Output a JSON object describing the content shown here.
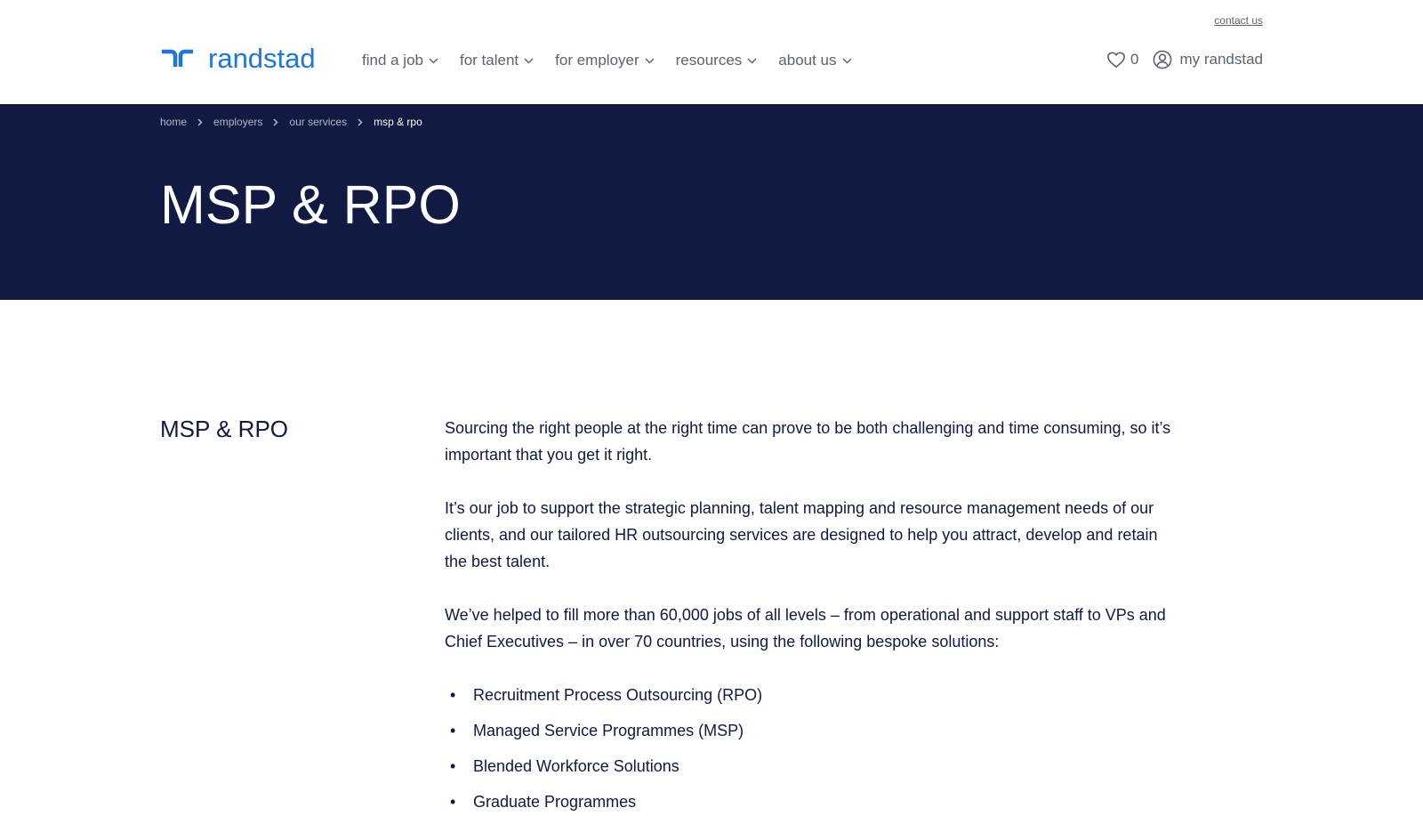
{
  "header": {
    "contact_link": "contact us",
    "logo_text": "randstad",
    "brand_color": "#2175d9",
    "nav": [
      {
        "label": "find a job"
      },
      {
        "label": "for talent"
      },
      {
        "label": "for employer"
      },
      {
        "label": "resources"
      },
      {
        "label": "about us"
      }
    ],
    "favorites_count": "0",
    "my_account_label": "my randstad"
  },
  "hero": {
    "background_color": "#101a43",
    "breadcrumbs": [
      "home",
      "employers",
      "our services",
      "msp & rpo"
    ],
    "title": "MSP & RPO"
  },
  "main": {
    "section_title": "MSP & RPO",
    "paragraphs": [
      "Sourcing the right people at the right time can prove to be both challenging and time consuming, so it’s important that you get it right.",
      "It’s our job to support the strategic planning, talent mapping and resource management needs of our clients, and our tailored HR outsourcing services are designed to help you attract, develop and retain the best talent.",
      "We’ve helped to fill more than 60,000 jobs of all levels – from operational and support staff to VPs and Chief Executives – in over 70 countries, using the following bespoke solutions:"
    ],
    "bullet_symbol": "•",
    "list_items": [
      "Recruitment Process Outsourcing (RPO)",
      "Managed Service Programmes (MSP)",
      "Blended Workforce Solutions",
      "Graduate Programmes"
    ]
  }
}
